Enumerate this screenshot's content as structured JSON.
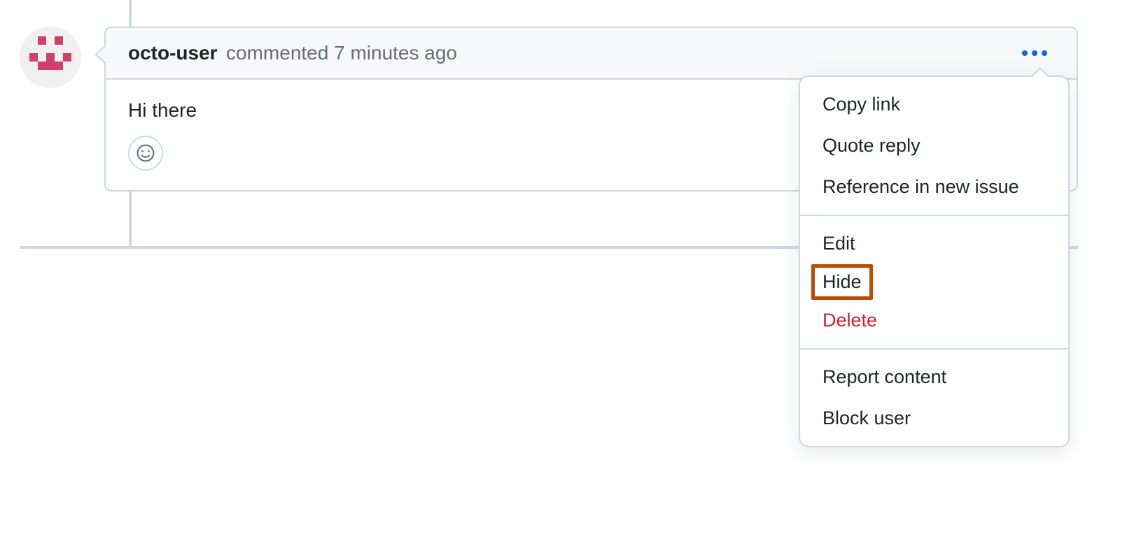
{
  "comment": {
    "author": "octo-user",
    "action_text": "commented 7 minutes ago",
    "body": "Hi there"
  },
  "dropdown": {
    "copy_link": "Copy link",
    "quote_reply": "Quote reply",
    "reference_new_issue": "Reference in new issue",
    "edit": "Edit",
    "hide": "Hide",
    "delete": "Delete",
    "report_content": "Report content",
    "block_user": "Block user"
  }
}
